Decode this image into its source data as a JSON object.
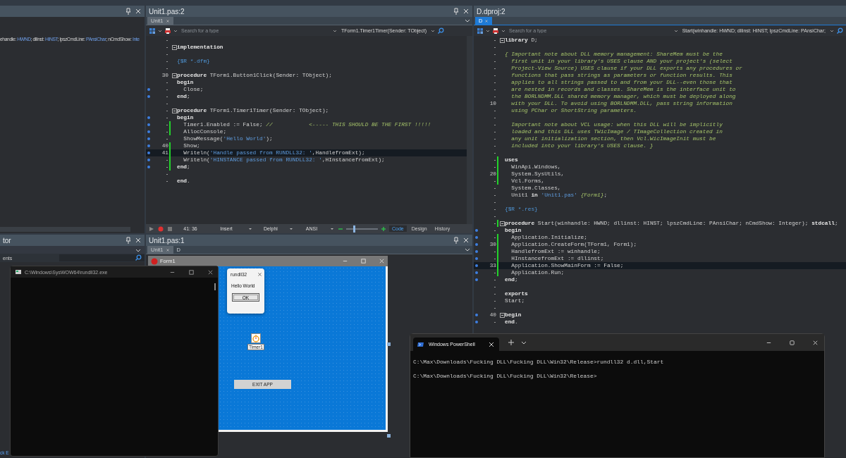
{
  "left_panel": {
    "code_line": [
      {
        "kind": "text",
        "text": "ehandle: "
      },
      {
        "kind": "type",
        "text": "HWND"
      },
      {
        "kind": "text",
        "text": "; dllinst: "
      },
      {
        "kind": "type",
        "text": "HINST"
      },
      {
        "kind": "text",
        "text": "; lpszCmdLine: "
      },
      {
        "kind": "type",
        "text": "PAnsiChar"
      },
      {
        "kind": "text",
        "text": "; nCmdShow: "
      },
      {
        "kind": "type",
        "text": "Inte"
      }
    ]
  },
  "inspector": {
    "title": "tor",
    "filter_label": "ents",
    "footer": "ck E"
  },
  "unit_editor": {
    "title": "Unit1.pas:2",
    "tabs": [
      {
        "label": "Unit1",
        "selected": true
      }
    ],
    "search": {
      "placeholder": "Search for a type"
    },
    "method": "TForm1.Timer1Timer(Sender: TObject)",
    "lines": [
      {
        "compiled": false,
        "modified": false,
        "fold": false,
        "current": false
      },
      {
        "compiled": false,
        "modified": false,
        "fold": true,
        "current": false,
        "tokens": [
          {
            "kind": "kw",
            "text": "implementation"
          }
        ]
      },
      {
        "compiled": false,
        "modified": false,
        "fold": false,
        "current": false
      },
      {
        "compiled": false,
        "modified": false,
        "fold": false,
        "current": false,
        "tokens": [
          {
            "kind": "dir",
            "text": "{$R *.dfm}"
          }
        ]
      },
      {
        "compiled": false,
        "modified": false,
        "fold": false,
        "current": false
      },
      {
        "n": "30",
        "compiled": false,
        "modified": false,
        "fold": true,
        "current": false,
        "tokens": [
          {
            "kind": "kw",
            "text": "procedure"
          },
          {
            "kind": "text",
            "text": " TForm1.Button1Click(Sender: TObject);"
          }
        ]
      },
      {
        "compiled": false,
        "modified": false,
        "fold": false,
        "current": false,
        "tokens": [
          {
            "kind": "kw",
            "text": "begin"
          }
        ]
      },
      {
        "compiled": true,
        "modified": false,
        "fold": false,
        "current": false,
        "tokens": [
          {
            "kind": "text",
            "text": "  Close;"
          }
        ]
      },
      {
        "compiled": true,
        "modified": false,
        "fold": false,
        "current": false,
        "tokens": [
          {
            "kind": "kw",
            "text": "end"
          },
          {
            "kind": "text",
            "text": ";"
          }
        ]
      },
      {
        "compiled": false,
        "modified": false,
        "fold": false,
        "current": false
      },
      {
        "compiled": false,
        "modified": false,
        "fold": true,
        "current": false,
        "tokens": [
          {
            "kind": "kw",
            "text": "procedure"
          },
          {
            "kind": "text",
            "text": " TForm1.Timer1Timer(Sender: TObject);"
          }
        ]
      },
      {
        "compiled": true,
        "modified": false,
        "fold": false,
        "current": false,
        "tokens": [
          {
            "kind": "kw",
            "text": "begin"
          }
        ]
      },
      {
        "compiled": true,
        "modified": true,
        "fold": false,
        "current": false,
        "tokens": [
          {
            "kind": "text",
            "text": "  Timer1.Enabled := False; "
          },
          {
            "kind": "com",
            "text": "//           <----- THIS SHOULD BE THE FIRST !!!!!"
          }
        ]
      },
      {
        "compiled": true,
        "modified": true,
        "fold": false,
        "current": false,
        "tokens": [
          {
            "kind": "text",
            "text": "  AllocConsole;"
          }
        ]
      },
      {
        "compiled": true,
        "modified": false,
        "fold": false,
        "current": false,
        "tokens": [
          {
            "kind": "text",
            "text": "  ShowMessage("
          },
          {
            "kind": "str",
            "text": "'Hello World'"
          },
          {
            "kind": "text",
            "text": ");"
          }
        ]
      },
      {
        "n": "40",
        "compiled": true,
        "modified": true,
        "fold": false,
        "current": false,
        "tokens": [
          {
            "kind": "text",
            "text": "  Show;"
          }
        ]
      },
      {
        "n": "41",
        "compiled": true,
        "modified": true,
        "fold": false,
        "current": true,
        "tokens": [
          {
            "kind": "text",
            "text": "  Writeln("
          },
          {
            "kind": "str",
            "text": "'Handle passed from RUNDLL32: '"
          },
          {
            "kind": "text",
            "text": ",HandlefromExt);"
          }
        ]
      },
      {
        "compiled": true,
        "modified": true,
        "fold": false,
        "current": false,
        "tokens": [
          {
            "kind": "text",
            "text": "  Writeln("
          },
          {
            "kind": "str",
            "text": "'HINSTANCE passed from RUNDLL32: '"
          },
          {
            "kind": "text",
            "text": ",HInstancefromExt);"
          }
        ]
      },
      {
        "compiled": true,
        "modified": true,
        "fold": false,
        "current": false,
        "tokens": [
          {
            "kind": "kw",
            "text": "end"
          },
          {
            "kind": "text",
            "text": ";"
          }
        ]
      },
      {
        "compiled": false,
        "modified": false,
        "fold": false,
        "current": false
      },
      {
        "compiled": false,
        "modified": false,
        "fold": false,
        "current": false,
        "tokens": [
          {
            "kind": "kw",
            "text": "end"
          },
          {
            "kind": "text",
            "text": "."
          }
        ]
      }
    ],
    "status": {
      "position": "41: 36",
      "mode": "Insert",
      "language": "Delphi",
      "encoding": "ANSI",
      "zoom": {
        "level": 0.25
      }
    },
    "view_tabs": [
      {
        "label": "Code",
        "selected": true
      },
      {
        "label": "Design",
        "selected": false
      },
      {
        "label": "History",
        "selected": false
      }
    ]
  },
  "project_editor": {
    "title": "D.dproj:2",
    "tabs": [
      {
        "label": "D",
        "selected": true
      }
    ],
    "search": {
      "placeholder": "Search for a type"
    },
    "method": "Start(winhandle: HWND; dllinst: HINST; lpszCmdLine: PAnsiChar;",
    "lines": [
      {
        "compiled": false,
        "modified": false,
        "fold": true,
        "current": false,
        "tokens": [
          {
            "kind": "kw",
            "text": "library"
          },
          {
            "kind": "text",
            "text": " D;"
          }
        ]
      },
      {
        "compiled": false,
        "modified": false,
        "fold": false,
        "current": false
      },
      {
        "compiled": false,
        "modified": false,
        "fold": false,
        "current": false,
        "tokens": [
          {
            "kind": "com",
            "text": "{ Important note about DLL memory management: ShareMem must be the"
          }
        ]
      },
      {
        "compiled": false,
        "modified": false,
        "fold": false,
        "current": false,
        "tokens": [
          {
            "kind": "com",
            "text": "  first unit in your library's USES clause AND your project's (select"
          }
        ]
      },
      {
        "compiled": false,
        "modified": false,
        "fold": false,
        "current": false,
        "tokens": [
          {
            "kind": "com",
            "text": "  Project-View Source) USES clause if your DLL exports any procedures or"
          }
        ]
      },
      {
        "compiled": false,
        "modified": false,
        "fold": false,
        "current": false,
        "tokens": [
          {
            "kind": "com",
            "text": "  functions that pass strings as parameters or function results. This"
          }
        ]
      },
      {
        "compiled": false,
        "modified": false,
        "fold": false,
        "current": false,
        "tokens": [
          {
            "kind": "com",
            "text": "  applies to all strings passed to and from your DLL--even those that"
          }
        ]
      },
      {
        "compiled": false,
        "modified": false,
        "fold": false,
        "current": false,
        "tokens": [
          {
            "kind": "com",
            "text": "  are nested in records and classes. ShareMem is the interface unit to"
          }
        ]
      },
      {
        "compiled": false,
        "modified": false,
        "fold": false,
        "current": false,
        "tokens": [
          {
            "kind": "com",
            "text": "  the BORLNDMM.DLL shared memory manager, which must be deployed along"
          }
        ]
      },
      {
        "n": "10",
        "compiled": false,
        "modified": false,
        "fold": false,
        "current": false,
        "tokens": [
          {
            "kind": "com",
            "text": "  with your DLL. To avoid using BORLNDMM.DLL, pass string information"
          }
        ]
      },
      {
        "compiled": false,
        "modified": false,
        "fold": false,
        "current": false,
        "tokens": [
          {
            "kind": "com",
            "text": "  using PChar or ShortString parameters."
          }
        ]
      },
      {
        "compiled": false,
        "modified": false,
        "fold": false,
        "current": false
      },
      {
        "compiled": false,
        "modified": false,
        "fold": false,
        "current": false,
        "tokens": [
          {
            "kind": "com",
            "text": "  Important note about VCL usage: when this DLL will be implicitly"
          }
        ]
      },
      {
        "compiled": false,
        "modified": false,
        "fold": false,
        "current": false,
        "tokens": [
          {
            "kind": "com",
            "text": "  loaded and this DLL uses TWicImage / TImageCollection created in"
          }
        ]
      },
      {
        "compiled": false,
        "modified": false,
        "fold": false,
        "current": false,
        "tokens": [
          {
            "kind": "com",
            "text": "  any unit initialization section, then Vcl.WicImageInit must be"
          }
        ]
      },
      {
        "compiled": false,
        "modified": false,
        "fold": false,
        "current": false,
        "tokens": [
          {
            "kind": "com",
            "text": "  included into your library's USES clause. }"
          }
        ]
      },
      {
        "compiled": false,
        "modified": false,
        "fold": false,
        "current": false
      },
      {
        "compiled": false,
        "modified": true,
        "fold": false,
        "current": false,
        "tokens": [
          {
            "kind": "kw",
            "text": "uses"
          }
        ]
      },
      {
        "compiled": false,
        "modified": true,
        "fold": false,
        "current": false,
        "tokens": [
          {
            "kind": "text",
            "text": "  WinApi.Windows,"
          }
        ]
      },
      {
        "n": "20",
        "compiled": false,
        "modified": true,
        "fold": false,
        "current": false,
        "tokens": [
          {
            "kind": "text",
            "text": "  System.SysUtils,"
          }
        ]
      },
      {
        "compiled": false,
        "modified": true,
        "fold": false,
        "current": false,
        "tokens": [
          {
            "kind": "text",
            "text": "  Vcl.Forms,"
          }
        ]
      },
      {
        "compiled": false,
        "modified": false,
        "fold": false,
        "current": false,
        "tokens": [
          {
            "kind": "text",
            "text": "  System.Classes,"
          }
        ]
      },
      {
        "compiled": false,
        "modified": false,
        "fold": false,
        "current": false,
        "tokens": [
          {
            "kind": "text",
            "text": "  Unit1 "
          },
          {
            "kind": "kw",
            "text": "in"
          },
          {
            "kind": "str",
            "text": " 'Unit1.pas'"
          },
          {
            "kind": "com",
            "text": " {Form1}"
          },
          {
            "kind": "text",
            "text": ";"
          }
        ]
      },
      {
        "compiled": false,
        "modified": false,
        "fold": false,
        "current": false
      },
      {
        "compiled": false,
        "modified": false,
        "fold": false,
        "current": false,
        "tokens": [
          {
            "kind": "dir",
            "text": "{$R *.res}"
          }
        ]
      },
      {
        "compiled": false,
        "modified": false,
        "fold": false,
        "current": false
      },
      {
        "compiled": false,
        "modified": true,
        "fold": true,
        "current": false,
        "tokens": [
          {
            "kind": "kw",
            "text": "procedure"
          },
          {
            "kind": "text",
            "text": " Start(winhandle: HWND; dllinst: HINST; lpszCmdLine: PAnsiChar; nCmdShow: Integer); "
          },
          {
            "kind": "kw",
            "text": "stdcall"
          },
          {
            "kind": "text",
            "text": ";"
          }
        ]
      },
      {
        "compiled": true,
        "modified": false,
        "fold": false,
        "current": false,
        "tokens": [
          {
            "kind": "kw",
            "text": "begin"
          }
        ]
      },
      {
        "compiled": true,
        "modified": true,
        "fold": false,
        "current": false,
        "tokens": [
          {
            "kind": "text",
            "text": "  Application.Initialize;"
          }
        ]
      },
      {
        "n": "30",
        "compiled": true,
        "modified": true,
        "fold": false,
        "current": false,
        "tokens": [
          {
            "kind": "text",
            "text": "  Application.CreateForm(TForm1, Form1);"
          }
        ]
      },
      {
        "compiled": true,
        "modified": true,
        "fold": false,
        "current": false,
        "tokens": [
          {
            "kind": "text",
            "text": "  HandlefromExt := winhandle;"
          }
        ]
      },
      {
        "compiled": true,
        "modified": true,
        "fold": false,
        "current": false,
        "tokens": [
          {
            "kind": "text",
            "text": "  HInstancefromExt := dllinst;"
          }
        ]
      },
      {
        "n": "33",
        "compiled": true,
        "modified": true,
        "fold": false,
        "current": true,
        "tokens": [
          {
            "kind": "text",
            "text": "  Application.ShowMainForm := False;"
          }
        ]
      },
      {
        "compiled": true,
        "modified": true,
        "fold": false,
        "current": false,
        "tokens": [
          {
            "kind": "text",
            "text": "  Application.Run;"
          }
        ]
      },
      {
        "compiled": true,
        "modified": false,
        "fold": false,
        "current": false,
        "tokens": [
          {
            "kind": "kw",
            "text": "end"
          },
          {
            "kind": "text",
            "text": ";"
          }
        ]
      },
      {
        "compiled": false,
        "modified": false,
        "fold": false,
        "current": false
      },
      {
        "compiled": false,
        "modified": false,
        "fold": false,
        "current": false,
        "tokens": [
          {
            "kind": "kw",
            "text": "exports"
          }
        ]
      },
      {
        "compiled": false,
        "modified": false,
        "fold": false,
        "current": false,
        "tokens": [
          {
            "kind": "text",
            "text": "Start;"
          }
        ]
      },
      {
        "compiled": false,
        "modified": false,
        "fold": false,
        "current": false
      },
      {
        "n": "40",
        "compiled": true,
        "modified": false,
        "fold": true,
        "current": false,
        "tokens": [
          {
            "kind": "kw",
            "text": "begin"
          }
        ]
      },
      {
        "compiled": true,
        "modified": false,
        "fold": false,
        "current": false,
        "tokens": [
          {
            "kind": "kw",
            "text": "end"
          },
          {
            "kind": "text",
            "text": "."
          }
        ]
      }
    ]
  },
  "designer": {
    "title": "Unit1.pas:1",
    "tabs": [
      {
        "label": "Unit1",
        "selected": true
      },
      {
        "label": "D",
        "selected": false
      }
    ],
    "form": {
      "title": "Form1",
      "timer": "Timer1",
      "button": "EXIT APP"
    }
  },
  "message_box": {
    "title": "rundll32",
    "message": "Hello World",
    "button": "OK"
  },
  "console_window": {
    "title": "C:\\Windows\\SysWOW64\\rundll32.exe"
  },
  "powershell": {
    "tab": "Windows PowerShell",
    "lines": [
      "C:\\Max\\Downloads\\Fucking DLL\\Fucking DLL\\Win32\\Release>rundll32 d.dll,Start",
      "C:\\Max\\Downloads\\Fucking DLL\\Fucking DLL\\Win32\\Release>"
    ]
  }
}
